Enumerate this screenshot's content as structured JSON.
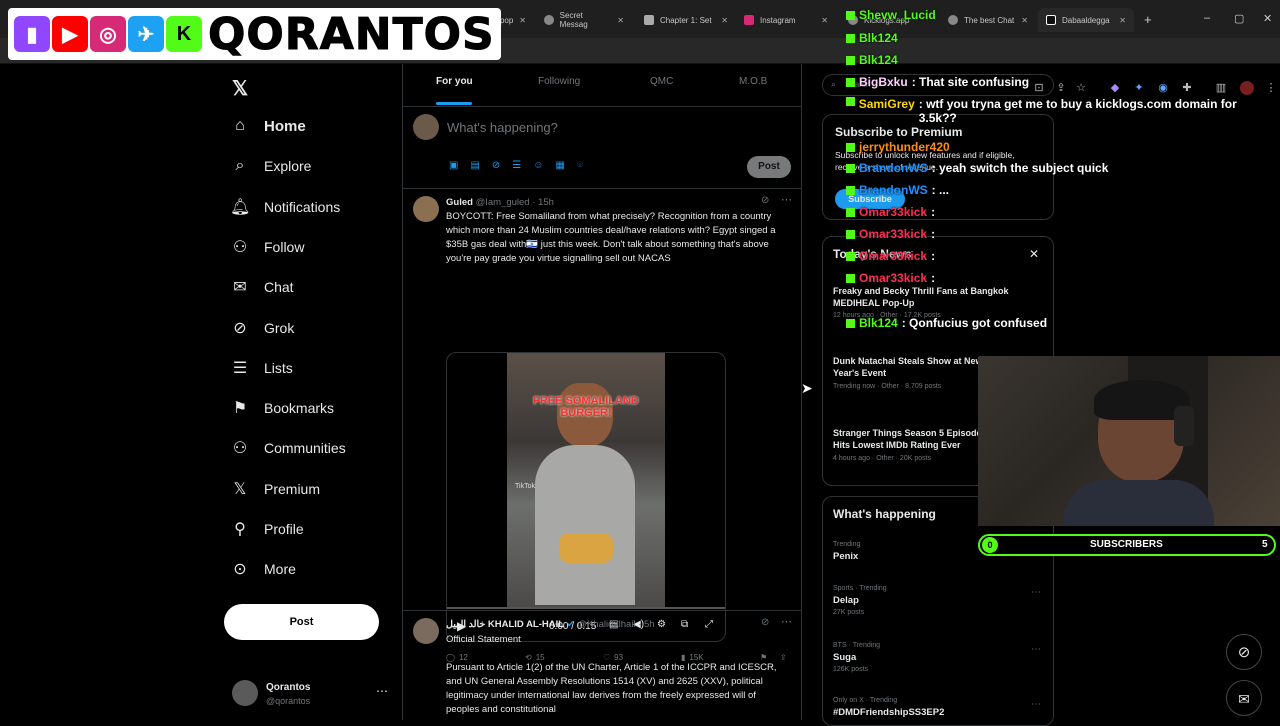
{
  "browser": {
    "tabs": [
      {
        "label": "kick.com/pop",
        "icon": "kick-icon"
      },
      {
        "label": "Secret Messag",
        "icon": "globe-icon"
      },
      {
        "label": "Chapter 1: Set",
        "icon": "book-icon"
      },
      {
        "label": "Instagram",
        "icon": "instagram-icon"
      },
      {
        "label": "Kicklogs.app",
        "icon": "globe-icon"
      },
      {
        "label": "The best Chat",
        "icon": "globe-icon"
      },
      {
        "label": "Dabaaldegga",
        "icon": "tiktok-icon"
      }
    ],
    "new_tab": "+"
  },
  "overlay_logo": {
    "text": "QORANTOS"
  },
  "nav": {
    "items": [
      {
        "label": "Home",
        "icon": "home-icon"
      },
      {
        "label": "Explore",
        "icon": "search-icon"
      },
      {
        "label": "Notifications",
        "icon": "bell-icon"
      },
      {
        "label": "Follow",
        "icon": "person-add-icon"
      },
      {
        "label": "Chat",
        "icon": "mail-icon"
      },
      {
        "label": "Grok",
        "icon": "grok-icon"
      },
      {
        "label": "Lists",
        "icon": "list-icon"
      },
      {
        "label": "Bookmarks",
        "icon": "bookmark-icon"
      },
      {
        "label": "Communities",
        "icon": "communities-icon"
      },
      {
        "label": "Premium",
        "icon": "x-icon"
      },
      {
        "label": "Profile",
        "icon": "person-icon"
      },
      {
        "label": "More",
        "icon": "more-circle-icon"
      }
    ],
    "post_label": "Post",
    "account": {
      "name": "Qorantos",
      "handle": "@qorantos"
    }
  },
  "feed": {
    "tabs": [
      "For you",
      "Following",
      "QMC",
      "M.O.B"
    ],
    "compose_placeholder": "What's happening?",
    "compose_post": "Post",
    "tweets": [
      {
        "name": "Guled",
        "handle": "@Iam_guled",
        "time": "15h",
        "text": "BOYCOTT: Free Somaliland from what precisely? Recognition from a country which more than 24 Muslim countries deal/have relations with? Egypt singed a $35B gas deal with🇮🇱 just this week. Don't talk about something that's above you're pay grade you virtue signalling sell out NACAS",
        "video": {
          "caption": "FREE SOMALILAND BURGER!",
          "watermark": "TikTok",
          "time": "0:00 / 0:15"
        },
        "replies": "12",
        "reposts": "15",
        "likes": "93",
        "views": "15K"
      },
      {
        "name": "خالد الهيل KHALID AL-HAIL",
        "handle": "@Khalidalhail",
        "time": "5h",
        "title": "Official Statement",
        "text": "Pursuant to Article 1(2) of the UN Charter, Article 1 of the ICCPR and ICESCR, and UN General Assembly Resolutions 1514 (XV) and 2625 (XXV), political legitimacy under international law derives from the freely expressed will of peoples and constitutional"
      }
    ]
  },
  "right": {
    "search_placeholder": "Search",
    "premium": {
      "title": "Subscribe to Premium",
      "text": "Subscribe to unlock new features and if eligible, receive a share of revenue.",
      "button": "Subscribe"
    },
    "news": {
      "title": "Today's News",
      "items": [
        {
          "title": "Freaky and Becky Thrill Fans at Bangkok MEDIHEAL Pop-Up",
          "meta": "12 hours ago · Other · 17.2K posts"
        },
        {
          "title": "Dunk Natachai Steals Show at New Year's Event",
          "meta": "Trending now · Other · 8,709 posts"
        },
        {
          "title": "Stranger Things Season 5 Episode Hits Lowest IMDb Rating Ever",
          "meta": "4 hours ago · Other · 20K posts"
        }
      ]
    },
    "happening": {
      "title": "What's happening",
      "trends": [
        {
          "meta": "Trending",
          "name": "Penix",
          "posts": ""
        },
        {
          "meta": "Sports · Trending",
          "name": "Delap",
          "posts": "27K posts"
        },
        {
          "meta": "BTS · Trending",
          "name": "Suga",
          "posts": "126K posts"
        },
        {
          "meta": "Only on X · Trending",
          "name": "#DMDFriendshipSS3EP2",
          "posts": ""
        }
      ]
    }
  },
  "chat": [
    {
      "user": "Shevw_Lucid",
      "color": "#53fc18",
      "msg": ""
    },
    {
      "user": "Blk124",
      "color": "#53fc18",
      "msg": ""
    },
    {
      "user": "Blk124",
      "color": "#53fc18",
      "msg": ""
    },
    {
      "user": "BigBxku",
      "color": "#ffd0ff",
      "msg": ": That site confusing"
    },
    {
      "user": "SamiGrey",
      "color": "#ffd700",
      "msg": ": wtf you tryna get me to buy a kicklogs.com domain for 3.5k??"
    },
    {
      "user": "jerrythunder420",
      "color": "#ff8c1a",
      "msg": ""
    },
    {
      "user": "BrandonWS",
      "color": "#1e90ff",
      "msg": ": yeah switch the subject quick"
    },
    {
      "user": "BrandonWS",
      "color": "#1e90ff",
      "msg": ": ..."
    },
    {
      "user": "Omar33kick",
      "color": "#ff2d55",
      "msg": ":"
    },
    {
      "user": "Omar33kick",
      "color": "#ff2d55",
      "msg": ":"
    },
    {
      "user": "Omar33kick",
      "color": "#ff2d55",
      "msg": ":"
    },
    {
      "user": "Omar33kick",
      "color": "#ff2d55",
      "msg": ":"
    },
    {
      "user": "Blk124",
      "color": "#53fc18",
      "msg": ": Qonfucius got confused"
    }
  ],
  "subscribers": {
    "current": "0",
    "label": "SUBSCRIBERS",
    "goal": "5"
  },
  "colors": {
    "accent": "#1d9bf0",
    "kick_green": "#53fc18",
    "bg": "#000000"
  }
}
